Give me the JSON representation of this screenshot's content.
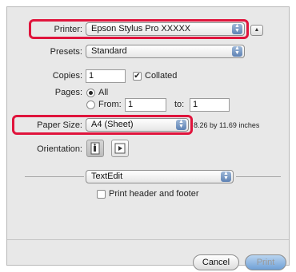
{
  "printer": {
    "label": "Printer:",
    "value": "Epson Stylus Pro XXXXX"
  },
  "presets": {
    "label": "Presets:",
    "value": "Standard"
  },
  "copies": {
    "label": "Copies:",
    "value": "1",
    "collated_label": "Collated",
    "collated_checked": true
  },
  "pages": {
    "label": "Pages:",
    "all_label": "All",
    "from_label": "From:",
    "from_value": "1",
    "to_label": "to:",
    "to_value": "1"
  },
  "paper_size": {
    "label": "Paper Size:",
    "value": "A4 (Sheet)",
    "dimensions": "8.26 by 11.69 inches"
  },
  "orientation": {
    "label": "Orientation:"
  },
  "section": {
    "value": "TextEdit"
  },
  "print_header": {
    "label": "Print header and footer"
  },
  "buttons": {
    "cancel": "Cancel",
    "print": "Print"
  },
  "colors": {
    "highlight": "#e0143c",
    "accent": "#5e82b4"
  }
}
